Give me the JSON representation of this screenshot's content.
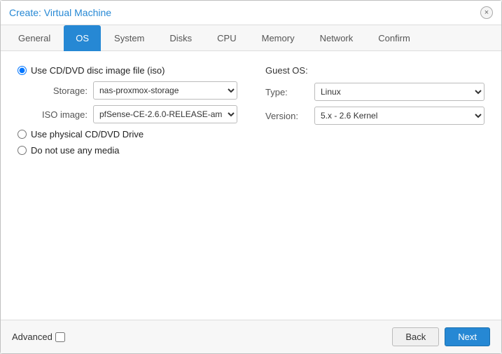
{
  "dialog": {
    "title": "Create: Virtual Machine",
    "close_label": "×"
  },
  "tabs": [
    {
      "id": "general",
      "label": "General",
      "state": "inactive"
    },
    {
      "id": "os",
      "label": "OS",
      "state": "active"
    },
    {
      "id": "system",
      "label": "System",
      "state": "inactive"
    },
    {
      "id": "disks",
      "label": "Disks",
      "state": "inactive"
    },
    {
      "id": "cpu",
      "label": "CPU",
      "state": "inactive"
    },
    {
      "id": "memory",
      "label": "Memory",
      "state": "inactive"
    },
    {
      "id": "network",
      "label": "Network",
      "state": "inactive"
    },
    {
      "id": "confirm",
      "label": "Confirm",
      "state": "inactive"
    }
  ],
  "content": {
    "use_iso_label": "Use CD/DVD disc image file (iso)",
    "storage_label": "Storage:",
    "storage_value": "nas-proxmox-storage",
    "iso_label": "ISO image:",
    "iso_value": "pfSense-CE-2.6.0-RELEASE-am",
    "use_physical_label": "Use physical CD/DVD Drive",
    "no_media_label": "Do not use any media",
    "guest_os_label": "Guest OS:",
    "type_label": "Type:",
    "type_value": "Linux",
    "version_label": "Version:",
    "version_value": "5.x - 2.6 Kernel"
  },
  "footer": {
    "advanced_label": "Advanced",
    "back_label": "Back",
    "next_label": "Next"
  }
}
